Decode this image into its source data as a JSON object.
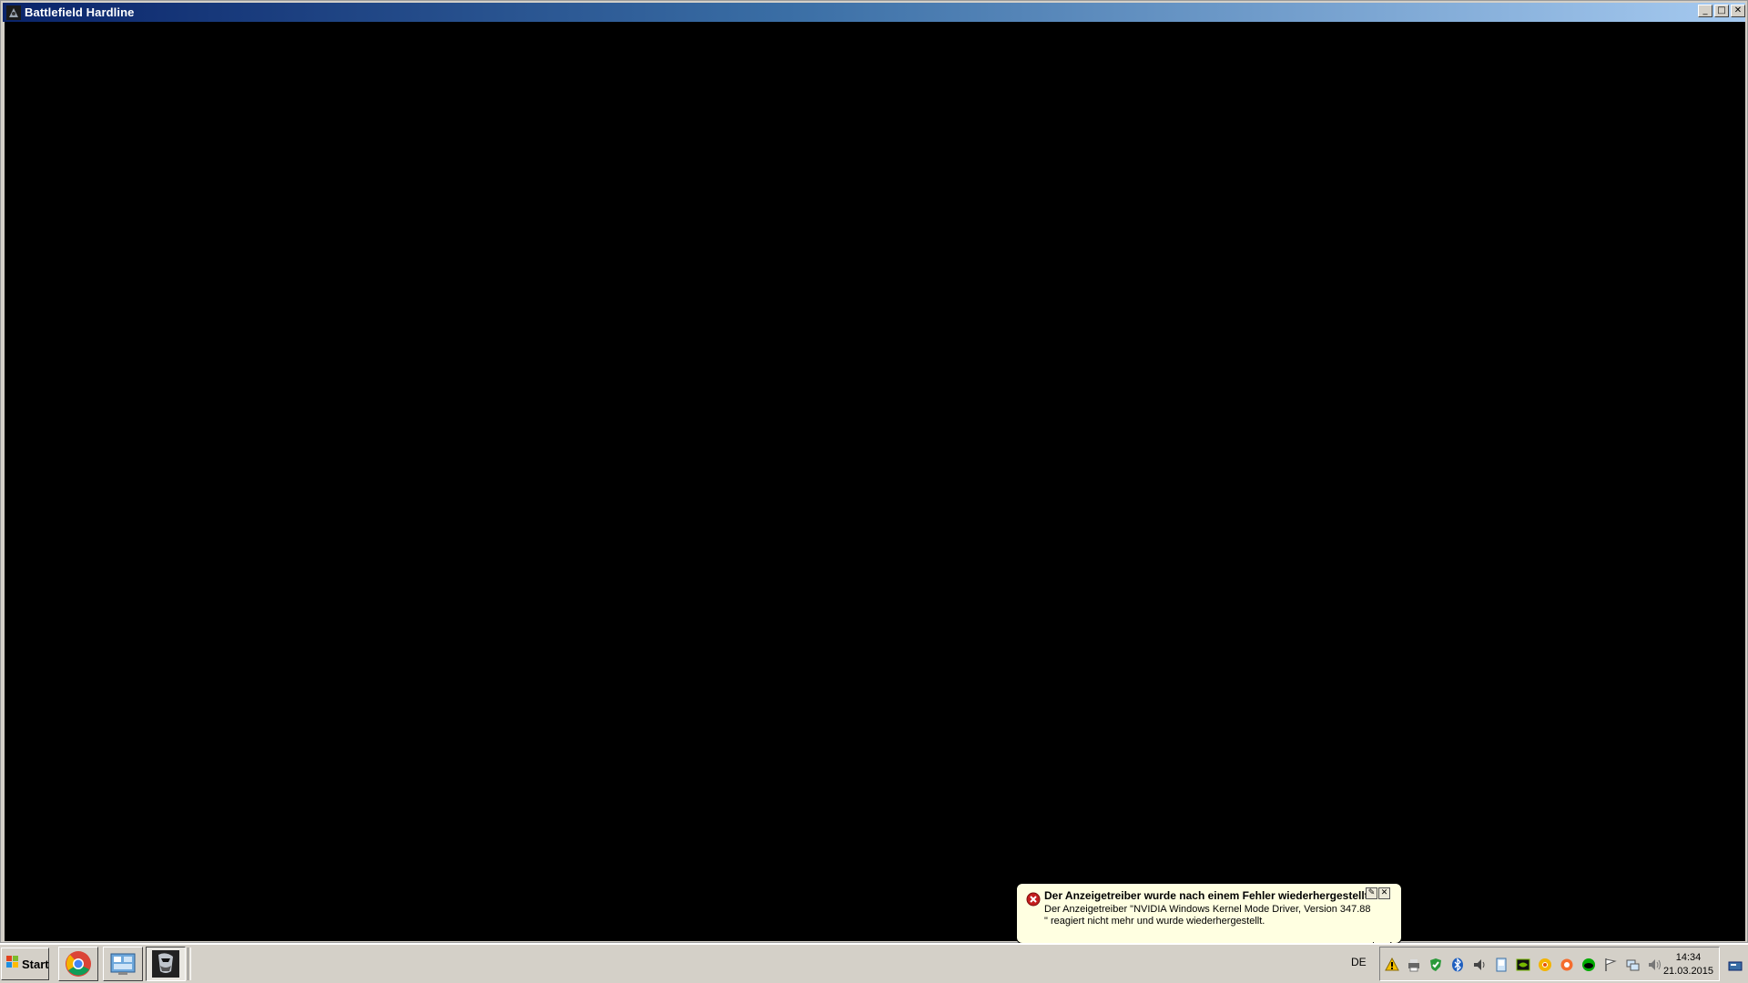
{
  "window": {
    "title": "Battlefield Hardline",
    "icon": "battlefield-app-icon",
    "controls": {
      "minimize": "_",
      "maximize": "□",
      "close": "✕"
    }
  },
  "balloon": {
    "title": "Der Anzeigetreiber wurde nach einem Fehler wiederhergestellt.",
    "body": "Der Anzeigetreiber \"NVIDIA Windows Kernel Mode Driver, Version 347.88 \" reagiert nicht mehr und wurde wiederhergestellt.",
    "icon": "error-icon",
    "tools": {
      "options": "✎",
      "close": "✕"
    }
  },
  "taskbar": {
    "start_label": "Start",
    "pinned": [
      {
        "name": "chrome-icon"
      },
      {
        "name": "control-panel-icon"
      },
      {
        "name": "battlefield-hardline-icon"
      }
    ],
    "language": "DE",
    "tray_icons": [
      "warning-icon",
      "printer-icon",
      "security-shield-icon",
      "bluetooth-icon",
      "speaker-network-icon",
      "device-icon",
      "nvidia-icon",
      "chrome-small-icon",
      "origin-icon",
      "green-cloud-icon",
      "action-center-flag-icon",
      "network-icon",
      "volume-icon"
    ],
    "clock": {
      "time": "14:34",
      "date": "21.03.2015"
    }
  },
  "colors": {
    "titlebar_start": "#0a246a",
    "titlebar_end": "#a6caf0",
    "balloon_bg": "#ffffe1",
    "error_red": "#c41e1e",
    "taskbar": "#d4d0c8"
  }
}
